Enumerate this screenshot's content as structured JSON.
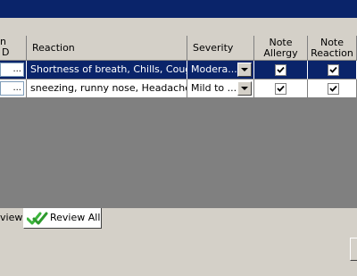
{
  "columns": {
    "id_line1": "n",
    "id_line2": "D",
    "reaction": "Reaction",
    "severity": "Severity",
    "note_allergy_line1": "Note",
    "note_allergy_line2": "Allergy",
    "note_reaction_line1": "Note",
    "note_reaction_line2": "Reaction"
  },
  "rows": [
    {
      "id": "...",
      "reaction": "Shortness of breath, Chills, Cough",
      "severity": "Modera...",
      "note_allergy": true,
      "note_reaction": true,
      "selected": true
    },
    {
      "id": "...",
      "reaction": "sneezing, runny nose, Headache, ...",
      "severity": "Mild to ...",
      "note_allergy": true,
      "note_reaction": true,
      "selected": false
    }
  ],
  "tabs": {
    "review_partial": "view",
    "review_all": "Review All"
  },
  "colors": {
    "selection": "#0a246a",
    "window_bg": "#d4d0c8",
    "grid_empty": "#808080",
    "check_icon": "#3cb43c"
  }
}
